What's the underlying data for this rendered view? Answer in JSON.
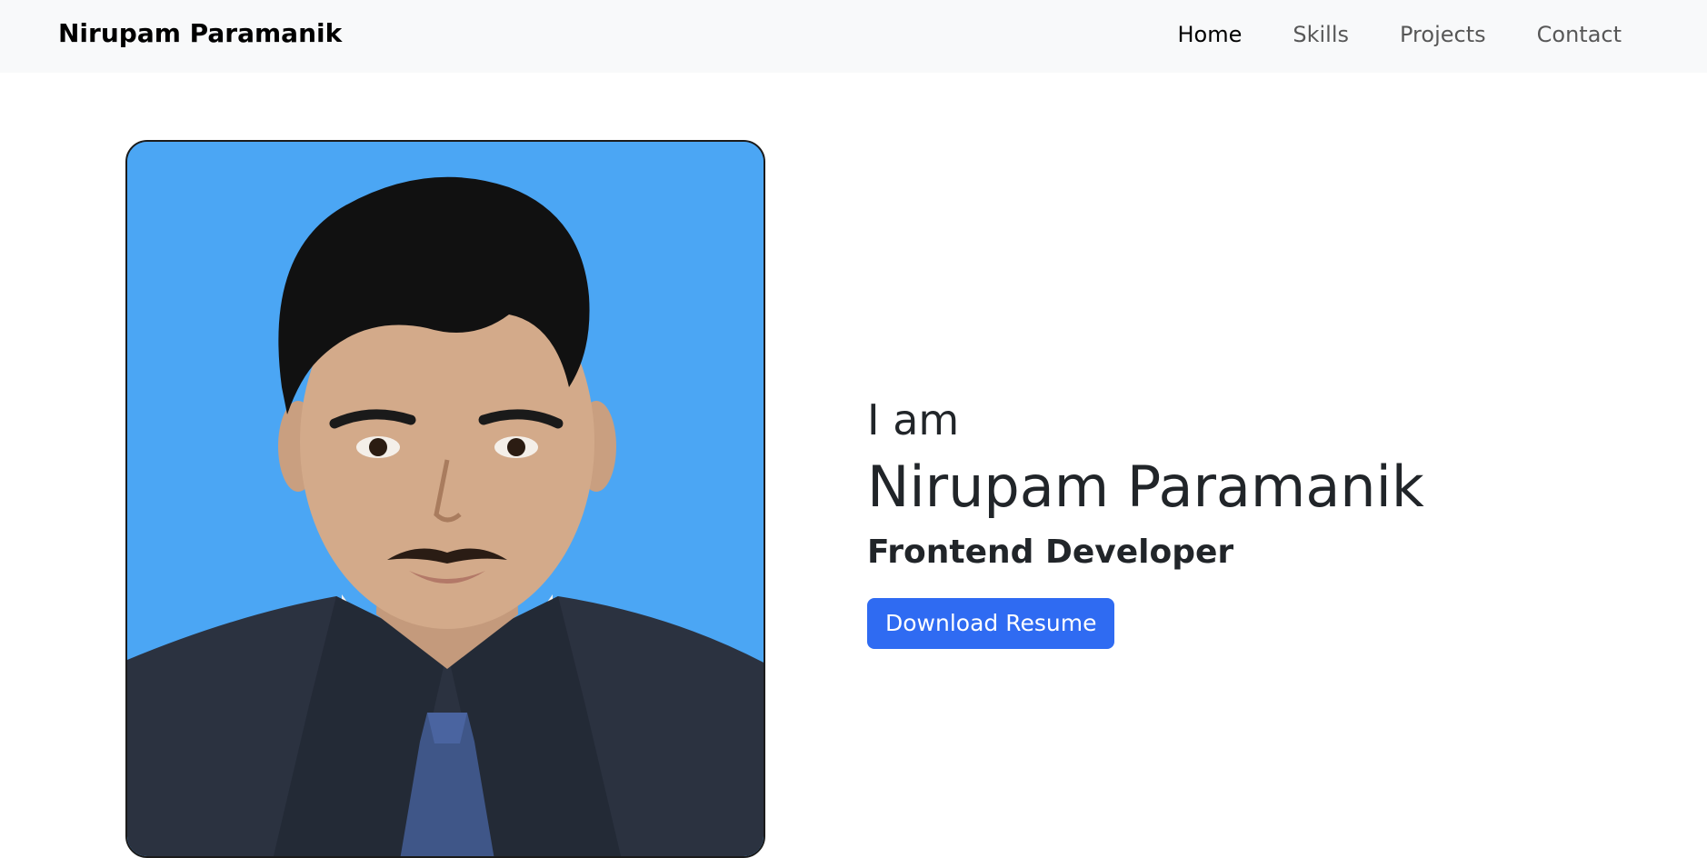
{
  "navbar": {
    "brand": "Nirupam Paramanik",
    "links": [
      {
        "label": "Home",
        "active": true
      },
      {
        "label": "Skills",
        "active": false
      },
      {
        "label": "Projects",
        "active": false
      },
      {
        "label": "Contact",
        "active": false
      }
    ]
  },
  "hero": {
    "greeting": "I am",
    "name": "Nirupam Paramanik",
    "role": "Frontend Developer",
    "button_label": "Download Resume"
  },
  "colors": {
    "navbar_bg": "#f8f9fa",
    "photo_bg": "#4ba6f4",
    "button_bg": "#2f6bf2"
  }
}
